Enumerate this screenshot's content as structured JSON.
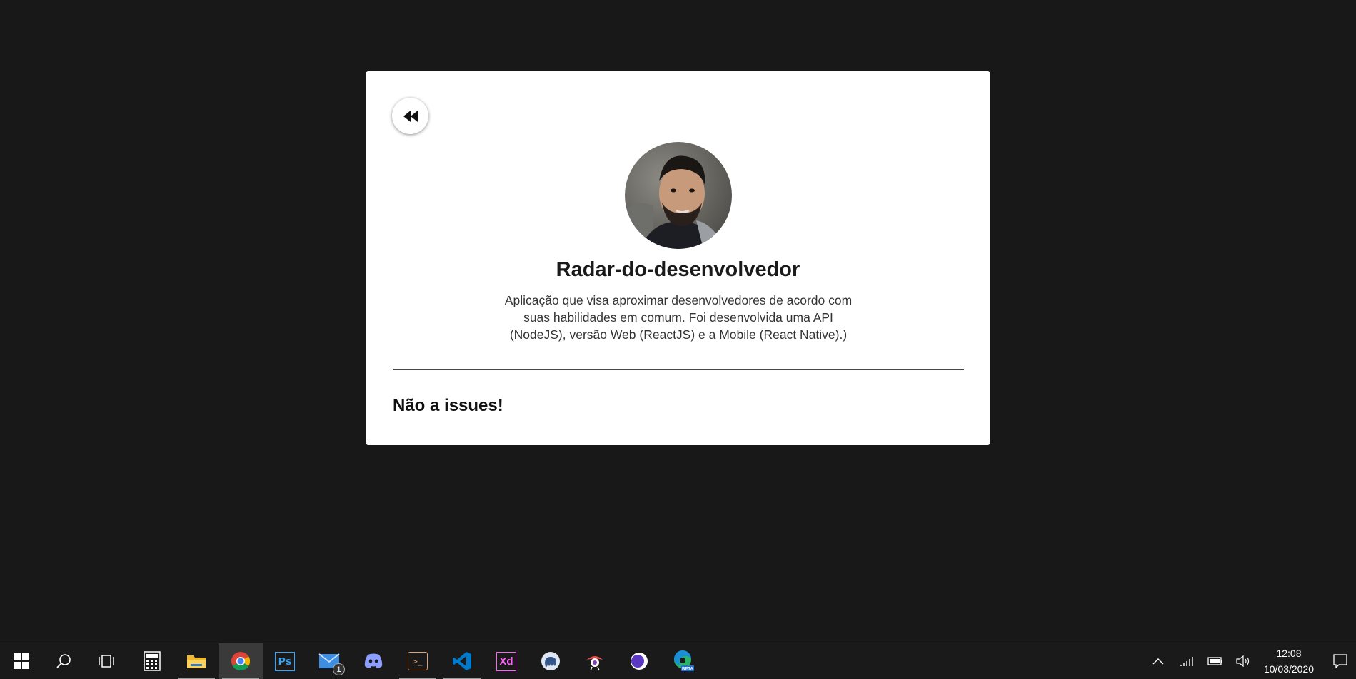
{
  "repo": {
    "title": "Radar-do-desenvolvedor",
    "description": "Aplicação que visa aproximar desenvolvedores de acordo com suas habilidades em comum. Foi desenvolvida uma API (NodeJS), versão Web (ReactJS) e a Mobile (React Native).)",
    "issues_message": "Não a issues!"
  },
  "back_button": {
    "icon": "rewind-icon"
  },
  "avatar": {
    "alt": "avatar"
  },
  "taskbar": {
    "apps": [
      {
        "name": "start",
        "icon": "windows-icon"
      },
      {
        "name": "search",
        "icon": "search-icon"
      },
      {
        "name": "task-view",
        "icon": "task-view-icon"
      },
      {
        "name": "calculator",
        "icon": "calculator-icon"
      },
      {
        "name": "file-explorer",
        "icon": "folder-icon"
      },
      {
        "name": "chrome",
        "icon": "chrome-icon"
      },
      {
        "name": "photoshop",
        "icon": "photoshop-icon",
        "label": "Ps"
      },
      {
        "name": "mail",
        "icon": "mail-icon",
        "badge": "1"
      },
      {
        "name": "discord",
        "icon": "discord-icon"
      },
      {
        "name": "hyper-terminal",
        "icon": "terminal-icon"
      },
      {
        "name": "vscode",
        "icon": "vscode-icon"
      },
      {
        "name": "adobe-xd",
        "icon": "xd-icon",
        "label": "Xd"
      },
      {
        "name": "tableplus",
        "icon": "elephant-icon"
      },
      {
        "name": "insomnia",
        "icon": "insomnia-icon"
      },
      {
        "name": "dark-app",
        "icon": "moon-icon"
      },
      {
        "name": "edge-beta",
        "icon": "edge-beta-icon",
        "label": "BETA"
      }
    ],
    "tray": {
      "time": "12:08",
      "date": "10/03/2020"
    }
  },
  "colors": {
    "background": "#181818",
    "card": "#ffffff",
    "taskbar": "#1a1a1a",
    "photoshop": "#31a8ff",
    "xd": "#ff61f6",
    "vscode": "#007acc"
  }
}
